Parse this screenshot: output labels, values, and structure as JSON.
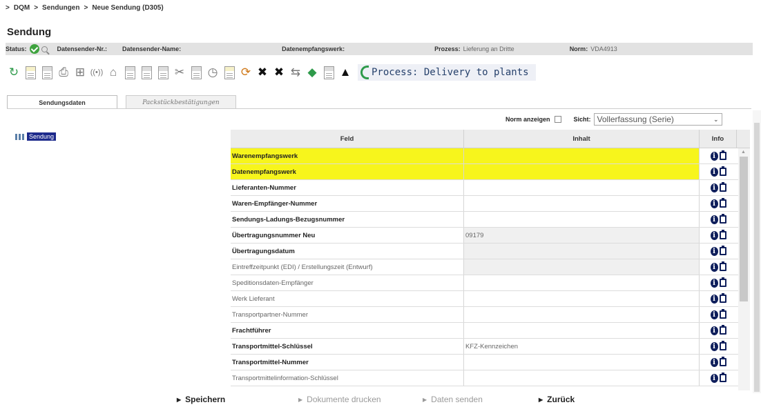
{
  "breadcrumb": {
    "prefix": ">",
    "items": [
      "DQM",
      "Sendungen",
      "Neue Sendung (D305)"
    ],
    "separator": ">"
  },
  "page_title": "Sendung",
  "status_bar": {
    "status_label": "Status:",
    "status_icon": "check-circle-icon",
    "sender_nr_label": "Datensender-Nr.:",
    "sender_name_label": "Datensender-Name:",
    "empfangswerk_label": "Datenempfangswerk:",
    "prozess_label": "Prozess:",
    "prozess_value": "Lieferung an Dritte",
    "norm_label": "Norm:",
    "norm_value": "VDA4913"
  },
  "toolbar": {
    "process_text": "Process: Delivery to plants",
    "icons": [
      "refresh-icon",
      "document-icon",
      "document-copy-icon",
      "print-icon",
      "grid-icon",
      "radio-icon",
      "tower-icon",
      "page-icon",
      "page-split-icon",
      "page-double-icon",
      "cut-icon",
      "paste-icon",
      "clock-icon",
      "document-edit-icon",
      "cycle-icon",
      "delete-icon",
      "delete-all-icon",
      "transfer-icon",
      "truck-icon",
      "preview-icon",
      "warning-bell-icon"
    ]
  },
  "tabs": {
    "active": "Sendungsdaten",
    "inactive": "Packstückbestätigungen"
  },
  "tree": {
    "node_label": "Sendung"
  },
  "options": {
    "norm_label": "Norm anzeigen",
    "norm_checked": false,
    "sicht_label": "Sicht:",
    "sicht_value": "Vollerfassung (Serie)"
  },
  "grid": {
    "headers": {
      "feld": "Feld",
      "inhalt": "Inhalt",
      "info": "Info"
    },
    "rows": [
      {
        "feld": "Warenempfangswerk",
        "inhalt": "",
        "style": "req hl"
      },
      {
        "feld": "Datenempfangswerk",
        "inhalt": "",
        "style": "req hl"
      },
      {
        "feld": "Lieferanten-Nummer",
        "inhalt": "",
        "style": "req"
      },
      {
        "feld": "Waren-Empfänger-Nummer",
        "inhalt": "",
        "style": "req"
      },
      {
        "feld": "Sendungs-Ladungs-Bezugsnummer",
        "inhalt": "",
        "style": "req"
      },
      {
        "feld": "Übertragungsnummer Neu",
        "inhalt": "09179",
        "style": "req ro"
      },
      {
        "feld": "Übertragungsdatum",
        "inhalt": "",
        "style": "req ro"
      },
      {
        "feld": "Eintreffzeitpunkt (EDI) / Erstellungszeit (Entwurf)",
        "inhalt": "",
        "style": "opt ro"
      },
      {
        "feld": "Speditionsdaten-Empfänger",
        "inhalt": "",
        "style": "opt"
      },
      {
        "feld": "Werk Lieferant",
        "inhalt": "",
        "style": "opt"
      },
      {
        "feld": "Transportpartner-Nummer",
        "inhalt": "",
        "style": "opt"
      },
      {
        "feld": "Frachtführer",
        "inhalt": "",
        "style": "req"
      },
      {
        "feld": "Transportmittel-Schlüssel",
        "inhalt": "KFZ-Kennzeichen",
        "style": "req"
      },
      {
        "feld": "Transportmittel-Nummer",
        "inhalt": "",
        "style": "req"
      },
      {
        "feld": "Transportmittelinformation-Schlüssel",
        "inhalt": "",
        "style": "opt"
      }
    ]
  },
  "footer": {
    "save": "Speichern",
    "print_docs": "Dokumente drucken",
    "send_data": "Daten senden",
    "back": "Zurück"
  },
  "colors": {
    "required_highlight": "#f7f51c",
    "tree_selected": "#1d2a8c",
    "info_icon": "#0e1e5b",
    "status_ok": "#3fa33f"
  }
}
